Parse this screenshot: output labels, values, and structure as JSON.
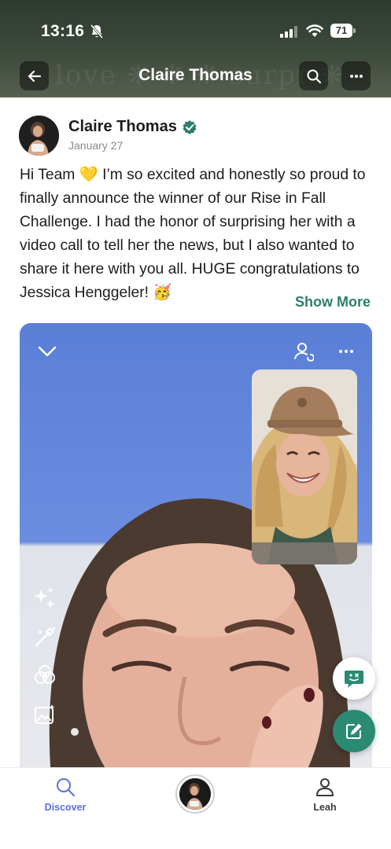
{
  "status_bar": {
    "time": "13:16",
    "battery": "71"
  },
  "header": {
    "title": "Claire Thomas",
    "back_icon": "back-arrow-icon",
    "search_icon": "search-icon",
    "more_icon": "more-icon"
  },
  "post": {
    "author": "Claire Thomas",
    "date": "January 27",
    "verified": true,
    "body": "Hi Team 💛 I’m so excited and honestly so proud to finally announce the winner of our Rise in Fall Challenge. I had the honor of surprising her with a video call to tell her the news, but I also wanted to share it here with you all. HUGE congratulations to Jessica Henggeler! 🥳",
    "show_more": "Show More"
  },
  "media": {
    "icons": [
      "chevron-down-icon",
      "person-swap-icon",
      "more-icon",
      "sparkles-icon",
      "magic-wand-icon",
      "filters-icon",
      "image-effects-icon"
    ]
  },
  "fabs": {
    "chat_icon": "chat-icon",
    "edit_icon": "edit-icon"
  },
  "bottom_nav": {
    "discover_label": "Discover",
    "leah_label": "Leah"
  },
  "colors": {
    "accent": "#2b8a72",
    "show_more": "#2e7d6c",
    "tab_active": "#5b6ee1",
    "verified": "#2e7d6c"
  }
}
